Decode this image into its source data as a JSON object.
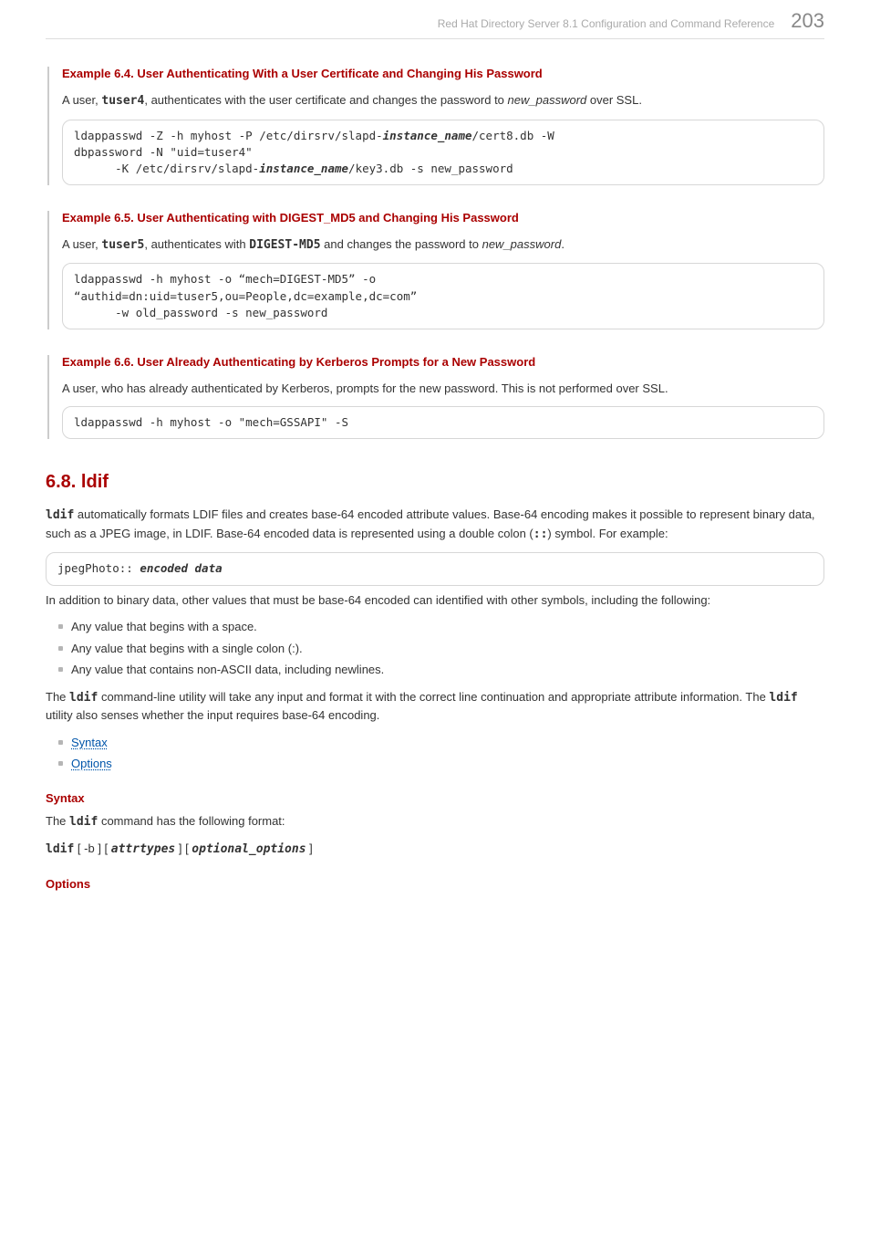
{
  "header": {
    "title": "Red Hat Directory Server 8.1 Configuration and Command Reference",
    "page": "203"
  },
  "ex64": {
    "title": "Example 6.4. User Authenticating With a User Certificate and Changing His Password",
    "p_pre": "A user, ",
    "user": "tuser4",
    "p_mid": ", authenticates with the user certificate and changes the password to ",
    "newpw": "new_password",
    "p_post": " over SSL.",
    "c1": "ldappasswd -Z -h myhost -P /etc/dirsrv/slapd-",
    "c1b": "instance_name",
    "c1c": "/cert8.db -W ",
    "c2": "dbpassword -N \"uid=tuser4\"",
    "c3a": "      -K /etc/dirsrv/slapd-",
    "c3b": "instance_name",
    "c3c": "/key3.db -s new_password"
  },
  "ex65": {
    "title": "Example 6.5. User Authenticating with DIGEST_MD5 and Changing His Password",
    "p_pre": "A user, ",
    "user": "tuser5",
    "p_mid": ", authenticates with ",
    "dm": "DIGEST-MD5",
    "p_mid2": " and changes the password to ",
    "newpw": "new_password",
    "p_post": ".",
    "c1": "ldappasswd -h myhost -o “mech=DIGEST-MD5” -o ",
    "c2": "“authid=dn:uid=tuser5,ou=People,dc=example,dc=com”",
    "c3": "      -w old_password -s new_password"
  },
  "ex66": {
    "title": "Example 6.6. User Already Authenticating by Kerberos Prompts for a New Password",
    "p": "A user, who has already authenticated by Kerberos, prompts for the new password. This is not performed over SSL.",
    "c1": "ldappasswd -h myhost -o \"mech=GSSAPI\" -S"
  },
  "sec68": {
    "title": "6.8. ldif",
    "p1a": "ldif",
    "p1b": " automatically formats LDIF files and creates base-64 encoded attribute values. Base-64 encoding makes it possible to represent binary data, such as a JPEG image, in LDIF. Base-64 encoded data is represented using a double colon (",
    "p1c": "::",
    "p1d": ") symbol. For example:",
    "cb_a": "jpegPhoto:: ",
    "cb_b": "encoded data",
    "p2": "In addition to binary data, other values that must be base-64 encoded can identified with other symbols, including the following:",
    "li1": "Any value that begins with a space.",
    "li2": "Any value that begins with a single colon (:).",
    "li3": "Any value that contains non-ASCII data, including newlines.",
    "p3a": "The ",
    "p3cmd": "ldif",
    "p3b": " command-line utility will take any input and format it with the correct line continuation and appropriate attribute information. The ",
    "p3cmd2": "ldif",
    "p3c": " utility also senses whether the input requires base-64 encoding.",
    "link1": "Syntax",
    "link2": "Options"
  },
  "syntax": {
    "title": "Syntax",
    "p_a": "The ",
    "p_cmd": "ldif",
    "p_b": " command has the following format:",
    "f_cmd": "ldif",
    "f_b1": " [ -b ] [ ",
    "f_attr": "attrtypes",
    "f_b2": " ] [ ",
    "f_opt": "optional_options",
    "f_b3": " ]"
  },
  "options": {
    "title": "Options"
  }
}
